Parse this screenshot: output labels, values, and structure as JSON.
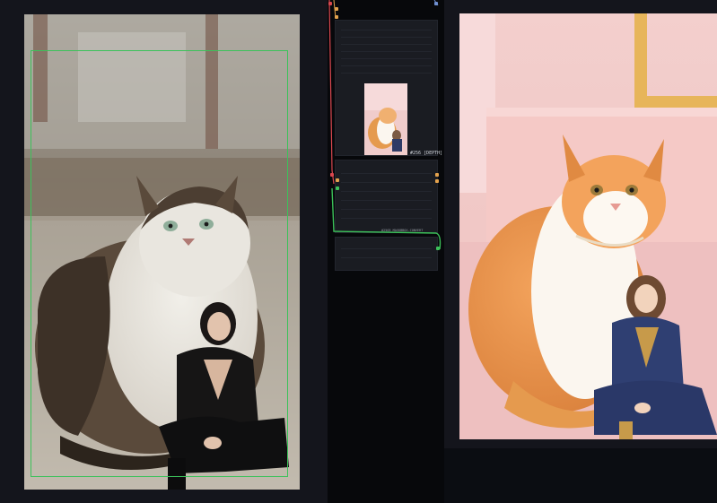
{
  "canvas": {
    "background": "#0b0d12",
    "node_background": "#14151c",
    "wire_colors": {
      "image": "#3cc25a",
      "mask": "#d9474f",
      "conditioning": "#e3a24d"
    }
  },
  "left_node": {
    "image_description": "photo-cat-and-woman-street",
    "bbox_color": "#3cc25a"
  },
  "middle": {
    "thumbnail_description": "generated-cat-and-woman-thumbnail",
    "size_label": "#256 [DEPTH]",
    "link_label": "#2503 MASKBBOX.CONVERT"
  },
  "right_node": {
    "image_description": "generated-orange-cat-and-woman-pink-room"
  }
}
